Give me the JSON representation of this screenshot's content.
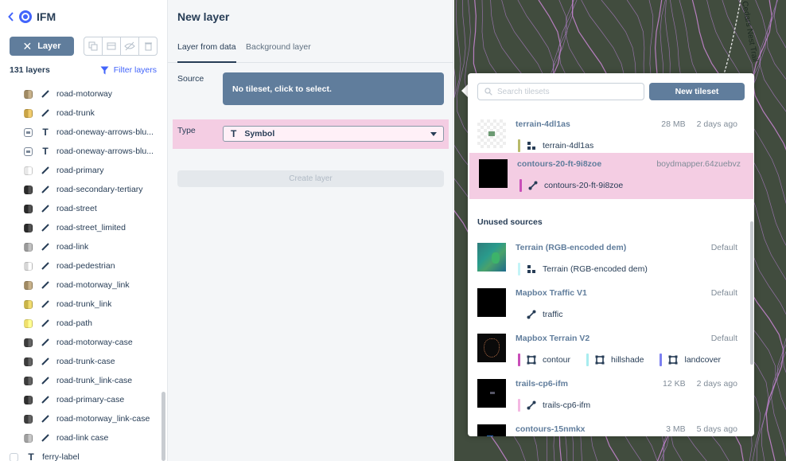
{
  "sidebar": {
    "style_name": "IFM",
    "layer_button_label": "Layer",
    "layers_count": "131 layers",
    "filter_label": "Filter layers",
    "layers": [
      {
        "name": "road-motorway",
        "type": "line",
        "color": "#a08a63"
      },
      {
        "name": "road-trunk",
        "type": "line",
        "color": "#c9a446"
      },
      {
        "name": "road-oneway-arrows-blu...",
        "type": "symbol",
        "color": "#7a8798"
      },
      {
        "name": "road-oneway-arrows-blu...",
        "type": "symbol",
        "color": "#7a8798"
      },
      {
        "name": "road-primary",
        "type": "line",
        "color": "#e8e8e8"
      },
      {
        "name": "road-secondary-tertiary",
        "type": "line",
        "color": "#2a2a2a"
      },
      {
        "name": "road-street",
        "type": "line",
        "color": "#2a2a2a"
      },
      {
        "name": "road-street_limited",
        "type": "line",
        "color": "#2a2a2a"
      },
      {
        "name": "road-link",
        "type": "line",
        "color": "#9a9a9a"
      },
      {
        "name": "road-pedestrian",
        "type": "line",
        "color": "#d6d6d6"
      },
      {
        "name": "road-motorway_link",
        "type": "line",
        "color": "#a08a63"
      },
      {
        "name": "road-trunk_link",
        "type": "line",
        "color": "#c9b449"
      },
      {
        "name": "road-path",
        "type": "line",
        "color": "#f0df6c"
      },
      {
        "name": "road-motorway-case",
        "type": "line",
        "color": "#3c3c3c"
      },
      {
        "name": "road-trunk-case",
        "type": "line",
        "color": "#3c3c3c"
      },
      {
        "name": "road-trunk_link-case",
        "type": "line",
        "color": "#3c3c3c"
      },
      {
        "name": "road-primary-case",
        "type": "line",
        "color": "#2f2f2f"
      },
      {
        "name": "road-motorway_link-case",
        "type": "line",
        "color": "#3c3c3c"
      },
      {
        "name": "road-link case",
        "type": "line",
        "color": "#a0a0a0"
      }
    ],
    "last_layer": {
      "name": "ferry-label",
      "type": "symbol"
    }
  },
  "panel": {
    "title": "New layer",
    "tabs": [
      "Layer from data",
      "Background layer"
    ],
    "source_label": "Source",
    "source_value": "No tileset, click to select.",
    "type_label": "Type",
    "type_value": "Symbol",
    "create_label": "Create layer"
  },
  "map": {
    "trail_label": "Cedars Nest Trail"
  },
  "popover": {
    "search_placeholder": "Search tilesets",
    "new_tileset_label": "New tileset",
    "unused_title": "Unused sources",
    "tilesets": [
      {
        "name": "terrain-4dl1as",
        "size": "28 MB",
        "date": "2 days ago",
        "thumb": "terrain",
        "layers": [
          {
            "name": "terrain-4dl1as",
            "color": "#b8ba6a",
            "geom": "raster"
          }
        ]
      },
      {
        "name": "contours-20-ft-9i8zoe",
        "size": "",
        "date": "boydmapper.64zuebvz",
        "thumb": "black",
        "selected": true,
        "layers": [
          {
            "name": "contours-20-ft-9i8zoe",
            "color": "#c94eb8",
            "geom": "line"
          }
        ]
      }
    ],
    "unused": [
      {
        "name": "Terrain (RGB-encoded dem)",
        "size": "",
        "date": "Default",
        "thumb": "rgb",
        "layers": [
          {
            "name": "Terrain (RGB-encoded dem)",
            "color": "#c3f4f7",
            "geom": "raster"
          }
        ]
      },
      {
        "name": "Mapbox Traffic V1",
        "size": "",
        "date": "Default",
        "thumb": "black",
        "layers": [
          {
            "name": "traffic",
            "color": "#ffffff",
            "geom": "line"
          }
        ]
      },
      {
        "name": "Mapbox Terrain V2",
        "size": "",
        "date": "Default",
        "thumb": "africa",
        "layers": [
          {
            "name": "contour",
            "color": "#c94eb8",
            "geom": "polygon"
          },
          {
            "name": "hillshade",
            "color": "#a8ecef",
            "geom": "polygon"
          },
          {
            "name": "landcover",
            "color": "#7b7ff0",
            "geom": "polygon"
          }
        ]
      },
      {
        "name": "trails-cp6-ifm",
        "size": "12 KB",
        "date": "2 days ago",
        "thumb": "trails",
        "layers": [
          {
            "name": "trails-cp6-ifm",
            "color": "#f4b8e2",
            "geom": "line"
          }
        ]
      },
      {
        "name": "contours-15nmkx",
        "size": "3 MB",
        "date": "5 days ago",
        "thumb": "contours",
        "layers": []
      }
    ]
  }
}
